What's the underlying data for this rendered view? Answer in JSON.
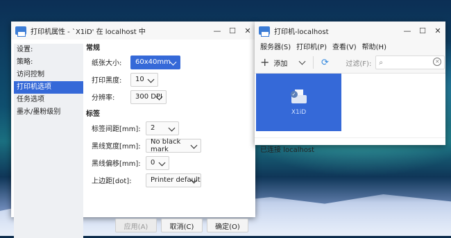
{
  "props_window": {
    "title": "打印机属性 - `X1iD' 在 localhost 中",
    "controls": {
      "minimize": "—",
      "maximize": "☐",
      "close": "✕"
    },
    "sidebar": [
      "设置:",
      "策略:",
      "访问控制",
      "打印机选项",
      "任务选项",
      "墨水/墨粉级别"
    ],
    "active_index": 3,
    "general": {
      "heading": "常规",
      "paper_size": {
        "label": "纸张大小:",
        "value": "60x40mm"
      },
      "darkness": {
        "label": "打印黑度:",
        "value": "10"
      },
      "resolution": {
        "label": "分辨率:",
        "value": "300 DPI"
      }
    },
    "label_section": {
      "heading": "标签",
      "gap": {
        "label": "标签间距[mm]:",
        "value": "2"
      },
      "black_mark_width": {
        "label": "黑线宽度[mm]:",
        "value": "No black mark"
      },
      "black_mark_offset": {
        "label": "黑线偏移[mm]:",
        "value": "0"
      },
      "top_margin": {
        "label": "上边距[dot]:",
        "value": "Printer default"
      }
    },
    "buttons": {
      "apply": "应用(A)",
      "cancel": "取消(C)",
      "ok": "确定(O)"
    }
  },
  "printers_window": {
    "title": "打印机-localhost",
    "controls": {
      "minimize": "—",
      "maximize": "☐",
      "close": "✕"
    },
    "menu": [
      "服务器(S)",
      "打印机(P)",
      "查看(V)",
      "帮助(H)"
    ],
    "toolbar": {
      "add": "添加",
      "filter_label": "过滤(F):",
      "filter_value": ""
    },
    "printer": {
      "name": "X1iD"
    },
    "status": "已连接 localhost"
  },
  "colors": {
    "accent": "#3569d8"
  }
}
